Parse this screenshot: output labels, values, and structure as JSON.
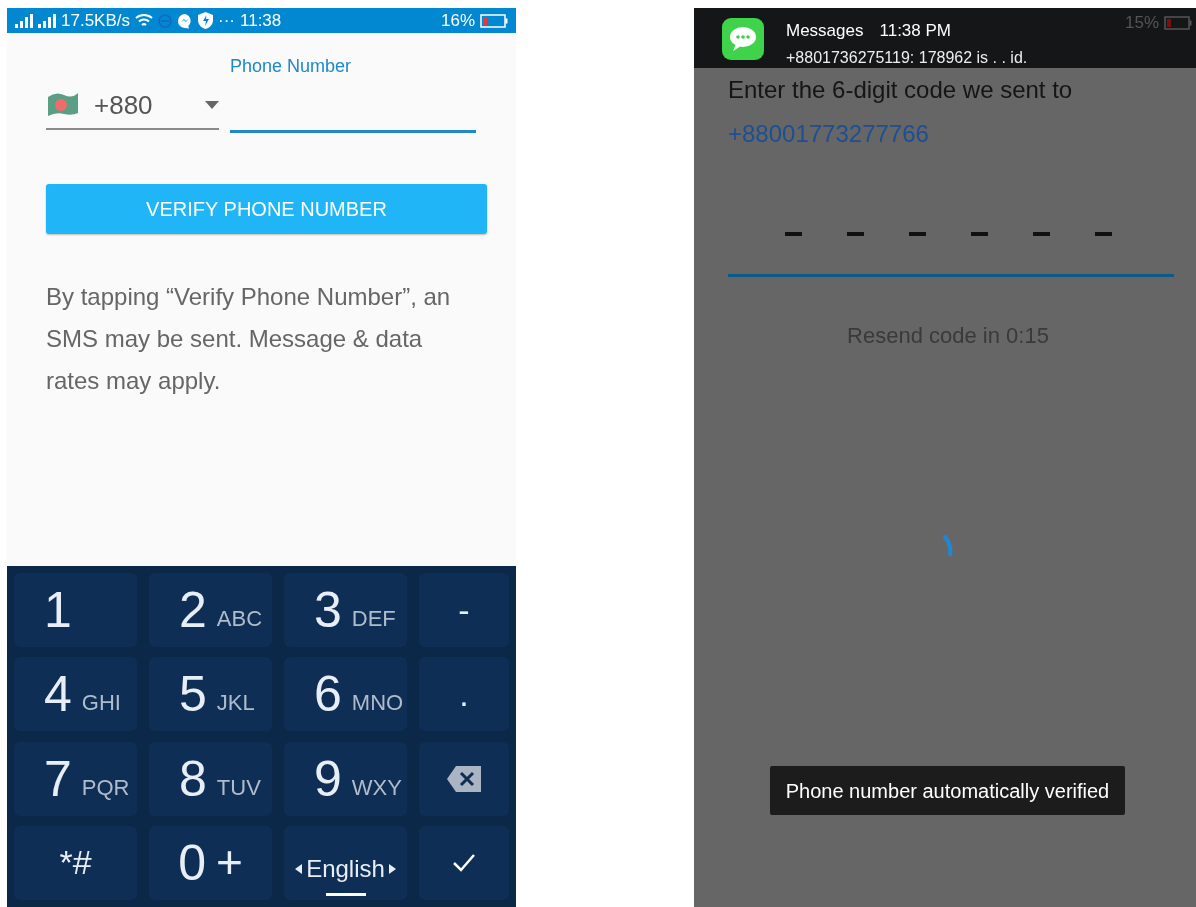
{
  "left_screen": {
    "status_bar": {
      "network_speed": "17.5KB/s",
      "more": "···",
      "time": "11:38",
      "battery": "16%"
    },
    "country_code": "+880",
    "phone_field": {
      "label": "Phone Number"
    },
    "verify_button": "VERIFY PHONE NUMBER",
    "disclaimer": "By tapping “Verify Phone Number”, an SMS may be sent. Message & data rates may apply.",
    "keypad": [
      {
        "kind": "digit",
        "main": "1"
      },
      {
        "kind": "digit",
        "main": "2",
        "letters": "ABC"
      },
      {
        "kind": "digit",
        "main": "3",
        "letters": "DEF"
      },
      {
        "kind": "symbol",
        "main": "-"
      },
      {
        "kind": "digit",
        "main": "4",
        "letters": "GHI"
      },
      {
        "kind": "digit",
        "main": "5",
        "letters": "JKL"
      },
      {
        "kind": "digit",
        "main": "6",
        "letters": "MNO"
      },
      {
        "kind": "symbol",
        "main": "."
      },
      {
        "kind": "digit",
        "main": "7",
        "letters": "PQR"
      },
      {
        "kind": "digit",
        "main": "8",
        "letters": "TUV"
      },
      {
        "kind": "digit",
        "main": "9",
        "letters": "WXY"
      },
      {
        "kind": "backspace"
      },
      {
        "kind": "symbol",
        "main": "*#"
      },
      {
        "kind": "digit_plus",
        "main": "0",
        "letters": "+"
      },
      {
        "kind": "language",
        "main": "English"
      },
      {
        "kind": "done"
      }
    ]
  },
  "right_screen": {
    "status_bar": {
      "battery": "15%"
    },
    "notification": {
      "app": "Messages",
      "time": "11:38 PM",
      "text": "+8801736275119: 178962 is . . id."
    },
    "prompt": "Enter the 6-digit code we sent to",
    "phone_number": "+88001773277766",
    "resend": "Resend code in 0:15",
    "toast": "Phone number automatically verified"
  }
}
